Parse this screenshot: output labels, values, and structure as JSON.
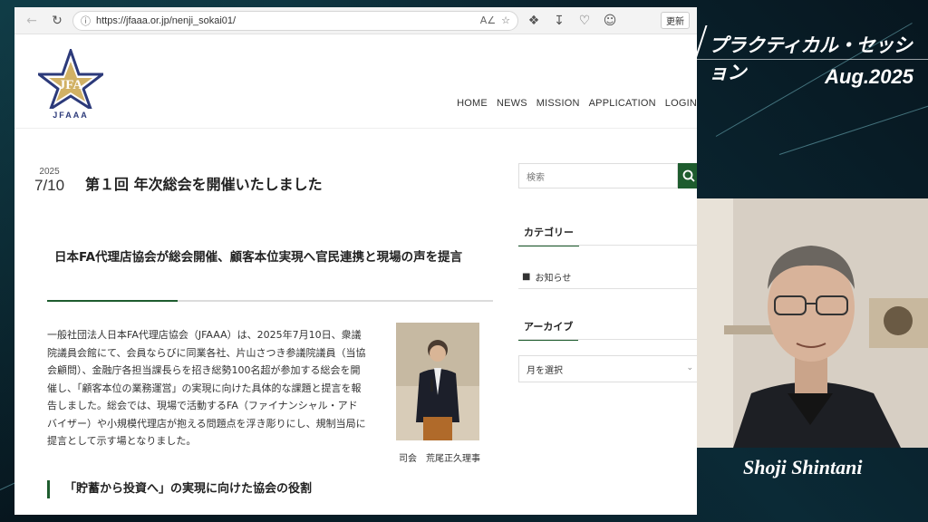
{
  "browser": {
    "url": "https://jfaaa.or.jp/nenji_sokai01/",
    "refresh_label": "更新",
    "icons": [
      "back-icon",
      "refresh-icon",
      "info-icon",
      "read-aloud-icon",
      "favorite-icon",
      "extensions-icon",
      "downloads-icon",
      "heart-icon",
      "profile-icon"
    ]
  },
  "site": {
    "logo_text": "JFAAA",
    "logo_letters": "JFA",
    "nav": [
      "HOME",
      "NEWS",
      "MISSION",
      "APPLICATION",
      "LOGIN"
    ]
  },
  "post": {
    "year": "2025",
    "date": "7/10",
    "title": "第１回 年次総会を開催いたしました",
    "sub_heading": "日本FA代理店協会が総会開催、顧客本位実現へ官民連携と現場の声を提言",
    "body": "一般社団法人日本FA代理店協会（JFAAA）は、2025年7月10日、衆議院議員会館にて、会員ならびに同業各社、片山さつき参議院議員（当協会顧問）、金融庁各担当課長らを招き総勢100名超が参加する総会を開催し、「顧客本位の業務運営」の実現に向けた具体的な課題と提言を報告しました。総会では、現場で活動するFA（ファイナンシャル・アドバイザー）や小規模代理店が抱える問題点を浮き彫りにし、規制当局に提言として示す場となりました。",
    "photo_caption": "司会　荒尾正久理事",
    "section_heading": "「貯蓄から投資へ」の実現に向けた協会の役割"
  },
  "sidebar": {
    "search_placeholder": "検索",
    "categories_heading": "カテゴリー",
    "category_item": "お知らせ",
    "archive_heading": "アーカイブ",
    "month_select": "月を選択"
  },
  "overlay": {
    "session_title": "プラクティカル・セッション",
    "session_date": "Aug.2025",
    "speaker_name": "Shoji Shintani"
  },
  "colors": {
    "accent_green": "#1e5c2e",
    "logo_navy": "#2c3a7a",
    "logo_gold": "#c9a34a"
  }
}
